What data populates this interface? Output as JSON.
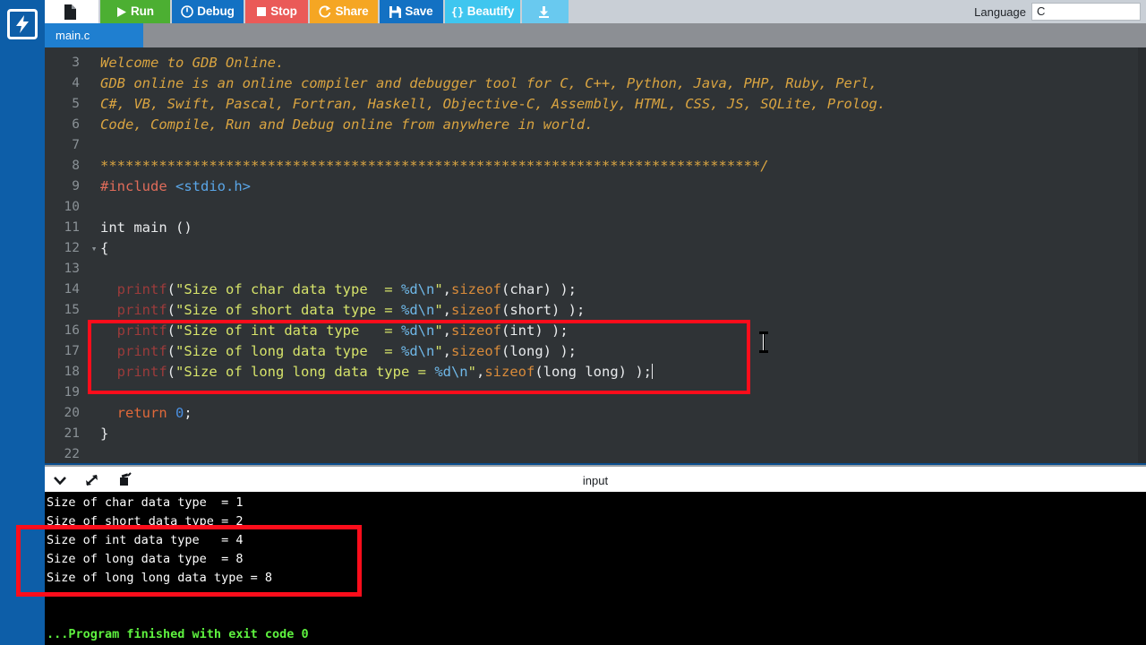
{
  "app": {
    "logo_icon": "lightning-bolt-icon",
    "language_label": "Language",
    "language_value": "C"
  },
  "toolbar": {
    "buttons": [
      {
        "id": "new-file",
        "label": "",
        "icon": "new-file-icon"
      },
      {
        "id": "run",
        "label": "Run",
        "icon": "play-icon"
      },
      {
        "id": "debug",
        "label": "Debug",
        "icon": "debug-circle-icon"
      },
      {
        "id": "stop",
        "label": "Stop",
        "icon": "stop-square-icon"
      },
      {
        "id": "share",
        "label": "Share",
        "icon": "share-icon"
      },
      {
        "id": "save",
        "label": "Save",
        "icon": "floppy-disk-icon"
      },
      {
        "id": "beautify",
        "label": "Beautify",
        "icon": "braces-icon"
      },
      {
        "id": "download",
        "label": "",
        "icon": "download-icon"
      }
    ]
  },
  "tabs": {
    "active_file": "main.c"
  },
  "editor": {
    "lines": [
      {
        "n": "3",
        "fold": false,
        "tokens": [
          {
            "t": "comment",
            "v": "Welcome to GDB Online."
          }
        ]
      },
      {
        "n": "4",
        "fold": false,
        "tokens": [
          {
            "t": "comment",
            "v": "GDB online is an online compiler and debugger tool for C, C++, Python, Java, PHP, Ruby, Perl,"
          }
        ]
      },
      {
        "n": "5",
        "fold": false,
        "tokens": [
          {
            "t": "comment",
            "v": "C#, VB, Swift, Pascal, Fortran, Haskell, Objective-C, Assembly, HTML, CSS, JS, SQLite, Prolog."
          }
        ]
      },
      {
        "n": "6",
        "fold": false,
        "tokens": [
          {
            "t": "comment",
            "v": "Code, Compile, Run and Debug online from anywhere in world."
          }
        ]
      },
      {
        "n": "7",
        "fold": false,
        "tokens": []
      },
      {
        "n": "8",
        "fold": false,
        "tokens": [
          {
            "t": "comment",
            "v": "*******************************************************************************/"
          }
        ]
      },
      {
        "n": "9",
        "fold": false,
        "tokens": [
          {
            "t": "pre",
            "v": "#include"
          },
          {
            "t": "plain",
            "v": " "
          },
          {
            "t": "hdr",
            "v": "<stdio.h>"
          }
        ]
      },
      {
        "n": "10",
        "fold": false,
        "tokens": []
      },
      {
        "n": "11",
        "fold": false,
        "tokens": [
          {
            "t": "kw",
            "v": "int main ()"
          }
        ]
      },
      {
        "n": "12",
        "fold": true,
        "tokens": [
          {
            "t": "punct",
            "v": "{"
          }
        ]
      },
      {
        "n": "13",
        "fold": false,
        "tokens": []
      },
      {
        "n": "14",
        "fold": false,
        "tokens": [
          {
            "t": "plain",
            "v": "  "
          },
          {
            "t": "fn",
            "v": "printf"
          },
          {
            "t": "punct",
            "v": "("
          },
          {
            "t": "str",
            "v": "\"Size of char data type  = "
          },
          {
            "t": "fmt",
            "v": "%d\\n"
          },
          {
            "t": "str",
            "v": "\""
          },
          {
            "t": "punct",
            "v": ","
          },
          {
            "t": "type",
            "v": "sizeof"
          },
          {
            "t": "punct",
            "v": "("
          },
          {
            "t": "plain",
            "v": "char"
          },
          {
            "t": "punct",
            "v": ") );"
          }
        ]
      },
      {
        "n": "15",
        "fold": false,
        "tokens": [
          {
            "t": "plain",
            "v": "  "
          },
          {
            "t": "fn",
            "v": "printf"
          },
          {
            "t": "punct",
            "v": "("
          },
          {
            "t": "str",
            "v": "\"Size of short data type = "
          },
          {
            "t": "fmt",
            "v": "%d\\n"
          },
          {
            "t": "str",
            "v": "\""
          },
          {
            "t": "punct",
            "v": ","
          },
          {
            "t": "type",
            "v": "sizeof"
          },
          {
            "t": "punct",
            "v": "("
          },
          {
            "t": "plain",
            "v": "short"
          },
          {
            "t": "punct",
            "v": ") );"
          }
        ]
      },
      {
        "n": "16",
        "fold": false,
        "tokens": [
          {
            "t": "plain",
            "v": "  "
          },
          {
            "t": "fn",
            "v": "printf"
          },
          {
            "t": "punct",
            "v": "("
          },
          {
            "t": "str",
            "v": "\"Size of int data type   = "
          },
          {
            "t": "fmt",
            "v": "%d\\n"
          },
          {
            "t": "str",
            "v": "\""
          },
          {
            "t": "punct",
            "v": ","
          },
          {
            "t": "type",
            "v": "sizeof"
          },
          {
            "t": "punct",
            "v": "("
          },
          {
            "t": "plain",
            "v": "int"
          },
          {
            "t": "punct",
            "v": ") );"
          }
        ]
      },
      {
        "n": "17",
        "fold": false,
        "tokens": [
          {
            "t": "plain",
            "v": "  "
          },
          {
            "t": "fn",
            "v": "printf"
          },
          {
            "t": "punct",
            "v": "("
          },
          {
            "t": "str",
            "v": "\"Size of long data type  = "
          },
          {
            "t": "fmt",
            "v": "%d\\n"
          },
          {
            "t": "str",
            "v": "\""
          },
          {
            "t": "punct",
            "v": ","
          },
          {
            "t": "type",
            "v": "sizeof"
          },
          {
            "t": "punct",
            "v": "("
          },
          {
            "t": "plain",
            "v": "long"
          },
          {
            "t": "punct",
            "v": ") );"
          }
        ]
      },
      {
        "n": "18",
        "fold": false,
        "tokens": [
          {
            "t": "plain",
            "v": "  "
          },
          {
            "t": "fn",
            "v": "printf"
          },
          {
            "t": "punct",
            "v": "("
          },
          {
            "t": "str",
            "v": "\"Size of long long data type = "
          },
          {
            "t": "fmt",
            "v": "%d\\n"
          },
          {
            "t": "str",
            "v": "\""
          },
          {
            "t": "punct",
            "v": ","
          },
          {
            "t": "type",
            "v": "sizeof"
          },
          {
            "t": "punct",
            "v": "("
          },
          {
            "t": "plain",
            "v": "long long"
          },
          {
            "t": "punct",
            "v": ") );"
          },
          {
            "t": "caret",
            "v": ""
          }
        ]
      },
      {
        "n": "19",
        "fold": false,
        "tokens": []
      },
      {
        "n": "20",
        "fold": false,
        "tokens": [
          {
            "t": "plain",
            "v": "  "
          },
          {
            "t": "ret",
            "v": "return"
          },
          {
            "t": "plain",
            "v": " "
          },
          {
            "t": "num",
            "v": "0"
          },
          {
            "t": "punct",
            "v": ";"
          }
        ]
      },
      {
        "n": "21",
        "fold": false,
        "tokens": [
          {
            "t": "punct",
            "v": "}"
          }
        ]
      },
      {
        "n": "22",
        "fold": false,
        "tokens": []
      }
    ]
  },
  "console": {
    "toolbar_icons": [
      "chevron-down-icon",
      "expand-arrows-icon",
      "clear-console-icon"
    ],
    "title": "input",
    "output_lines": [
      {
        "text": "Size of char data type  = 1",
        "style": "normal"
      },
      {
        "text": "Size of short data type = 2",
        "style": "normal"
      },
      {
        "text": "Size of int data type   = 4",
        "style": "normal"
      },
      {
        "text": "Size of long data type  = 8",
        "style": "normal"
      },
      {
        "text": "Size of long long data type = 8",
        "style": "normal"
      },
      {
        "text": "",
        "style": "normal"
      },
      {
        "text": "",
        "style": "normal"
      },
      {
        "text": "...Program finished with exit code 0",
        "style": "done"
      }
    ]
  },
  "annotations": {
    "code_highlight_color": "#fc0d1b",
    "output_highlight_color": "#fc0d1b"
  }
}
